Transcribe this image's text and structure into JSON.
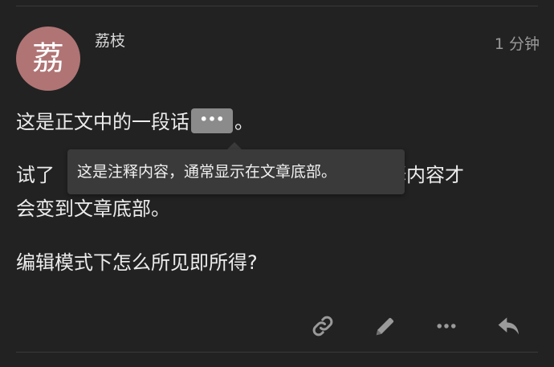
{
  "post": {
    "author": "荔枝",
    "avatar_char": "荔",
    "time": "1 分钟",
    "paragraph1_text": "这是正文中的一段话",
    "paragraph1_tail": "。",
    "footnote_button_label": "•••",
    "paragraph2_visible_start": "试了",
    "paragraph2_visible_end": "且注释内容才",
    "paragraph2_line2": "会变到文章底部。",
    "paragraph3": "编辑模式下怎么所见即所得?"
  },
  "tooltip": {
    "text": "这是注释内容，通常显示在文章底部。"
  },
  "actions": {
    "icons": [
      "link-icon",
      "pencil-icon",
      "ellipsis-icon",
      "reply-icon"
    ]
  },
  "colors": {
    "background": "#222222",
    "avatar": "#b07474",
    "footnote_button": "#8b8b8b",
    "tooltip_bg": "#3a3a3a",
    "icon": "#9a9a9a"
  }
}
